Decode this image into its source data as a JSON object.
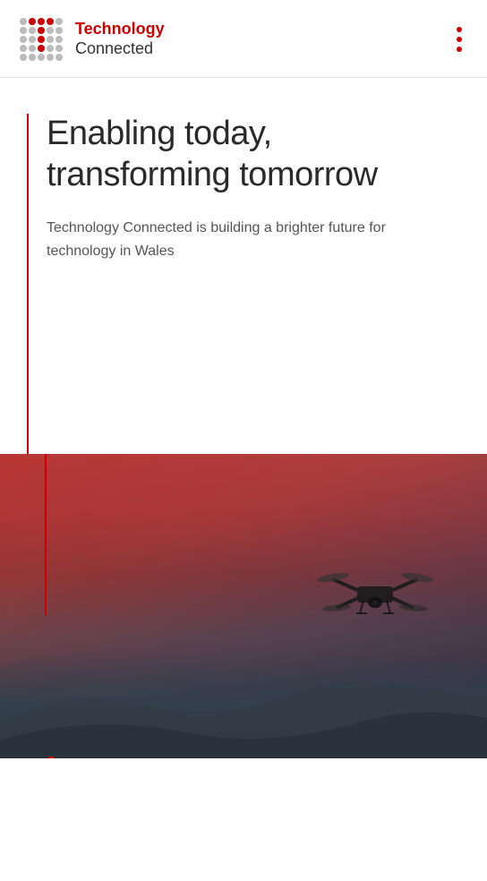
{
  "header": {
    "brand_technology": "Technology",
    "brand_connected": "Connected",
    "menu_icon": "more-vertical-icon"
  },
  "hero": {
    "headline": "Enabling today, transforming tomorrow",
    "subtext": "Technology Connected is building a brighter future for technology in Wales"
  },
  "colors": {
    "red": "#cc0000",
    "text_dark": "#2a2a2a",
    "text_mid": "#555555"
  }
}
